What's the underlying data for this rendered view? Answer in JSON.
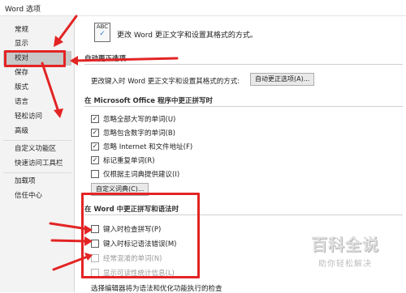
{
  "window": {
    "title": "Word 选项"
  },
  "sidebar": {
    "items": [
      {
        "label": "常规"
      },
      {
        "label": "显示"
      },
      {
        "label": "校对",
        "selected": true
      },
      {
        "label": "保存"
      },
      {
        "label": "版式"
      },
      {
        "label": "语言"
      },
      {
        "label": "轻松访问"
      },
      {
        "label": "高级"
      },
      {
        "label": "自定义功能区"
      },
      {
        "label": "快速访问工具栏"
      },
      {
        "label": "加载项"
      },
      {
        "label": "信任中心"
      }
    ]
  },
  "main": {
    "intro_icon_text": "ABC",
    "intro": "更改 Word 更正文字和设置其格式的方式。",
    "autocorrect": {
      "section_title": "自动更正选项",
      "description": "更改键入时 Word 更正文字和设置其格式的方式:",
      "button_label": "自动更正选项(A)..."
    },
    "office_spelling": {
      "section_title": "在 Microsoft Office 程序中更正拼写时",
      "options": [
        {
          "label": "忽略全部大写的单词(U)",
          "checked": true
        },
        {
          "label": "忽略包含数字的单词(B)",
          "checked": true
        },
        {
          "label": "忽略 Internet 和文件地址(F)",
          "checked": true
        },
        {
          "label": "标记重复单词(R)",
          "checked": true
        },
        {
          "label": "仅根据主词典提供建议(I)",
          "checked": false
        }
      ],
      "custom_dict_button": "自定义词典(C)..."
    },
    "word_spelling": {
      "section_title": "在 Word 中更正拼写和语法时",
      "options": [
        {
          "label": "键入时检查拼写(P)",
          "checked": false,
          "disabled": false
        },
        {
          "label": "键入时标记语法错误(M)",
          "checked": false,
          "disabled": false
        },
        {
          "label": "经常混淆的单词(N)",
          "checked": false,
          "disabled": true
        },
        {
          "label": "显示可读性统计信息(L)",
          "checked": false,
          "disabled": true
        }
      ],
      "truncated_text": "选择编辑器将为语法和优化功能执行的检查"
    }
  },
  "watermark": {
    "main": "百科全说",
    "sub": "助你轻松解决"
  },
  "colors": {
    "annotation_red": "#e32424",
    "selected_bg": "#c8c8c8",
    "sidebar_bg": "#f3f3f3"
  }
}
